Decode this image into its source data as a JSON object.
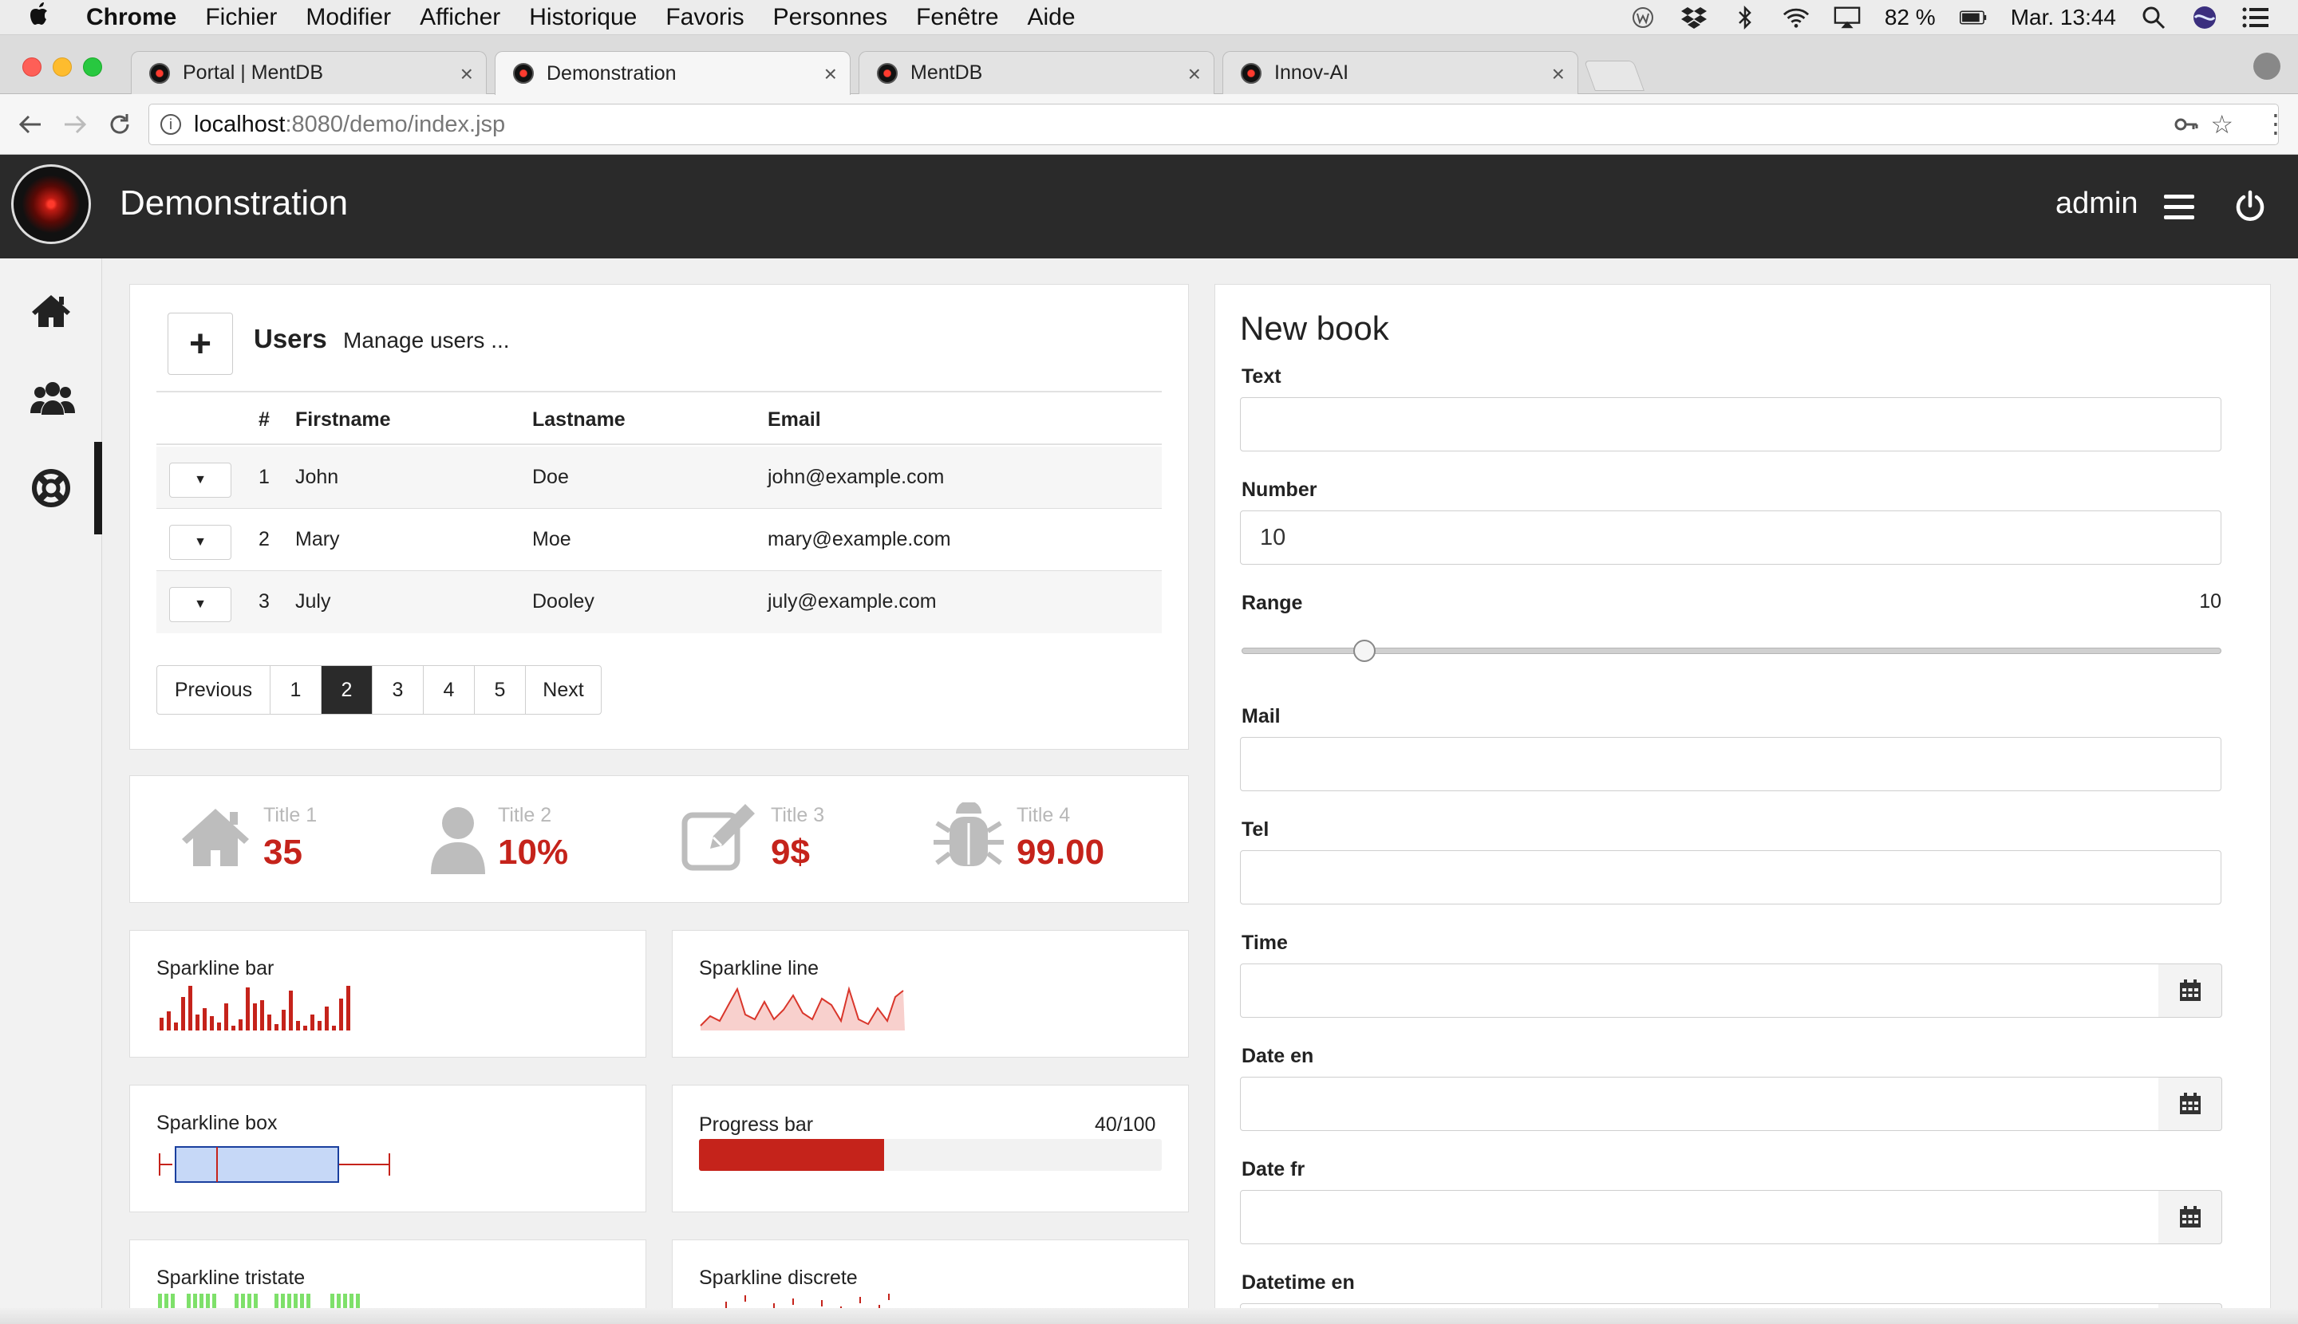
{
  "menubar": {
    "items": [
      "Chrome",
      "Fichier",
      "Modifier",
      "Afficher",
      "Historique",
      "Favoris",
      "Personnes",
      "Fenêtre",
      "Aide"
    ],
    "battery": "82 %",
    "clock": "Mar. 13:44"
  },
  "tabs": [
    {
      "label": "Portal | MentDB"
    },
    {
      "label": "Demonstration"
    },
    {
      "label": "MentDB"
    },
    {
      "label": "Innov-AI"
    }
  ],
  "address": {
    "host": "localhost",
    "path": ":8080/demo/index.jsp"
  },
  "app": {
    "title": "Demonstration",
    "user": "admin"
  },
  "users": {
    "title": "Users",
    "subtitle": "Manage users ...",
    "add_label": "+",
    "columns": [
      "#",
      "Firstname",
      "Lastname",
      "Email"
    ],
    "rows": [
      {
        "id": "1",
        "firstname": "John",
        "lastname": "Doe",
        "email": "john@example.com"
      },
      {
        "id": "2",
        "firstname": "Mary",
        "lastname": "Moe",
        "email": "mary@example.com"
      },
      {
        "id": "3",
        "firstname": "July",
        "lastname": "Dooley",
        "email": "july@example.com"
      }
    ],
    "pagination": {
      "previous": "Previous",
      "pages": [
        "1",
        "2",
        "3",
        "4",
        "5"
      ],
      "current": "2",
      "next": "Next"
    }
  },
  "stats": [
    {
      "title": "Title 1",
      "value": "35",
      "icon": "home-icon"
    },
    {
      "title": "Title 2",
      "value": "10%",
      "icon": "user-icon"
    },
    {
      "title": "Title 3",
      "value": "9$",
      "icon": "edit-icon"
    },
    {
      "title": "Title 4",
      "value": "99.00",
      "icon": "bug-icon"
    }
  ],
  "cards": {
    "sparkline_bar": "Sparkline bar",
    "sparkline_line": "Sparkline line",
    "sparkline_box": "Sparkline box",
    "progress_label": "Progress bar",
    "progress_value": "40/100",
    "progress_fraction": 0.4,
    "sparkline_tristate": "Sparkline tristate",
    "sparkline_discrete": "Sparkline discrete"
  },
  "colors": {
    "accent": "#c5231b",
    "header": "#2a2a2a",
    "box_fill": "#c6d8f7",
    "tristate_pos": "#7ee06a"
  },
  "form": {
    "title": "New book",
    "fields": {
      "text": {
        "label": "Text",
        "value": ""
      },
      "number": {
        "label": "Number",
        "value": "10"
      },
      "range": {
        "label": "Range",
        "value": "10",
        "fraction": 0.125
      },
      "mail": {
        "label": "Mail",
        "value": ""
      },
      "tel": {
        "label": "Tel",
        "value": ""
      },
      "time": {
        "label": "Time",
        "value": ""
      },
      "date_en": {
        "label": "Date en",
        "value": ""
      },
      "date_fr": {
        "label": "Date fr",
        "value": ""
      },
      "datetime_en": {
        "label": "Datetime en",
        "value": ""
      }
    }
  }
}
